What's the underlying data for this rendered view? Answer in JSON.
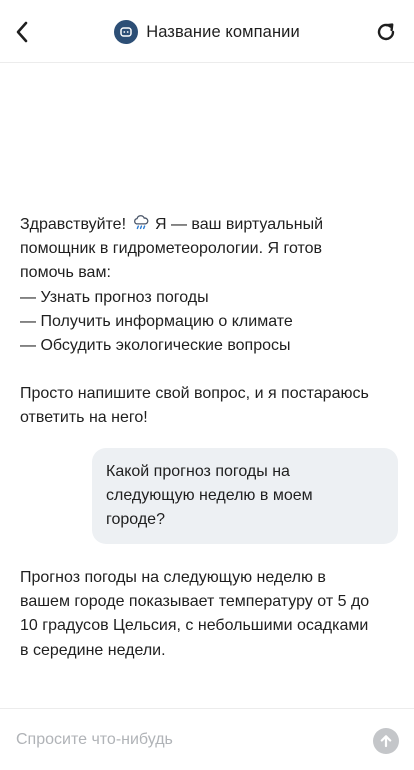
{
  "header": {
    "title": "Название компании",
    "back_icon": "chevron-left-icon",
    "reload_icon": "reload-icon",
    "logo_icon": "chatbot-icon"
  },
  "messages": {
    "greeting": {
      "line1_before_emoji": "Здравствуйте!",
      "emoji": "cloud-with-rain-icon",
      "line1_after_emoji": "Я — ваш виртуальный",
      "line2": "помощник в гидрометеорологии. Я готов",
      "line3": "помочь вам:",
      "item1": "— Узнать прогноз погоды",
      "item2": "— Получить информацию о климате",
      "item3": "— Обсудить экологические вопросы",
      "closing_line1": "Просто напишите свой вопрос, и я постараюсь",
      "closing_line2": "ответить на него!"
    },
    "user_question": {
      "line1": "Какой прогноз погоды на",
      "line2": "следующую неделю в моем",
      "line3": "городе?"
    },
    "bot_answer": {
      "line1": "Прогноз погоды на следующую неделю в",
      "line2": "вашем городе показывает температуру от 5 до",
      "line3": "10 градусов Цельсия, с небольшими осадками",
      "line4": "в середине недели."
    }
  },
  "input": {
    "placeholder": "Спросите что-нибудь",
    "value": "",
    "send_icon": "arrow-up-icon"
  },
  "colors": {
    "brand": "#2d4f76",
    "user_bubble": "#edf0f3",
    "send_disabled": "#c4c6c9",
    "placeholder": "#b0b3b7"
  }
}
